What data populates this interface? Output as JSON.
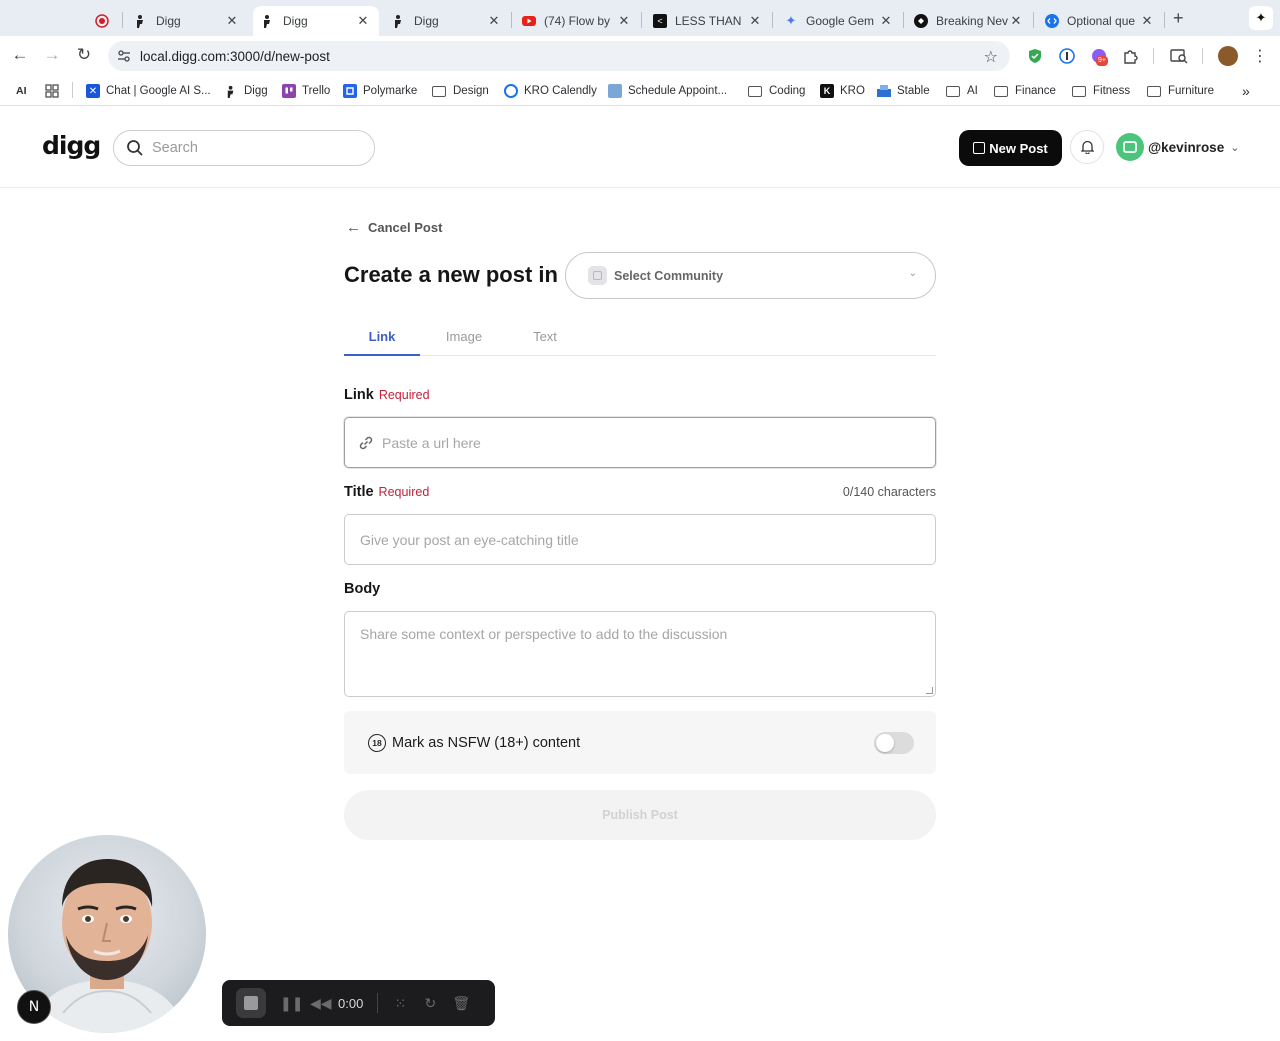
{
  "browser": {
    "tabs": [
      {
        "label": "",
        "icon": "record-icon",
        "active": false
      },
      {
        "label": "Digg",
        "icon": "digg-icon",
        "active": false
      },
      {
        "label": "Digg",
        "icon": "digg-icon",
        "active": true
      },
      {
        "label": "Digg",
        "icon": "digg-icon",
        "active": false
      },
      {
        "label": "(74) Flow by",
        "icon": "youtube-icon",
        "active": false
      },
      {
        "label": "LESS THAN",
        "icon": "lessthan-icon",
        "active": false
      },
      {
        "label": "Google Gem",
        "icon": "gemini-icon",
        "active": false
      },
      {
        "label": "Breaking Nev",
        "icon": "breaking-icon",
        "active": false
      },
      {
        "label": "Optional que",
        "icon": "optional-icon",
        "active": false
      }
    ],
    "new_tab": "+",
    "url": "local.digg.com:3000/d/new-post",
    "bookmarks": [
      {
        "label": "AI",
        "type": "text"
      },
      {
        "label": "",
        "type": "apps"
      },
      {
        "label": "Chat | Google AI S...",
        "type": "site"
      },
      {
        "label": "Digg",
        "type": "site"
      },
      {
        "label": "Trello",
        "type": "site"
      },
      {
        "label": "Polymarke",
        "type": "site"
      },
      {
        "label": "Design",
        "type": "folder"
      },
      {
        "label": "KRO Calendly",
        "type": "site"
      },
      {
        "label": "Schedule Appoint...",
        "type": "site"
      },
      {
        "label": "Coding",
        "type": "folder"
      },
      {
        "label": "KRO",
        "type": "site"
      },
      {
        "label": "Stable",
        "type": "site"
      },
      {
        "label": "AI",
        "type": "folder"
      },
      {
        "label": "Finance",
        "type": "folder"
      },
      {
        "label": "Fitness",
        "type": "folder"
      },
      {
        "label": "Furniture",
        "type": "folder"
      }
    ],
    "bookmarks_overflow": "»",
    "extension_badge": "9+"
  },
  "header": {
    "logo": "digg",
    "search_placeholder": "Search",
    "new_post_label": "New Post",
    "username": "@kevinrose"
  },
  "form": {
    "cancel_label": "Cancel Post",
    "title_prefix": "Create a new post in",
    "community_placeholder": "Select Community",
    "tabs": [
      {
        "label": "Link",
        "active": true
      },
      {
        "label": "Image",
        "active": false
      },
      {
        "label": "Text",
        "active": false
      }
    ],
    "link_label": "Link",
    "required_label": "Required",
    "link_placeholder": "Paste a url here",
    "title_label": "Title",
    "title_counter": "0/140 characters",
    "title_placeholder": "Give your post an eye-catching title",
    "body_label": "Body",
    "body_placeholder": "Share some context or perspective to add to the discussion",
    "nsfw_badge": "18",
    "nsfw_label": "Mark as NSFW (18+) content",
    "nsfw_enabled": false,
    "publish_label": "Publish Post"
  },
  "overlay": {
    "n_badge": "N",
    "recorder_time": "0:00"
  },
  "colors": {
    "accent_blue": "#3d5fc9",
    "required_red": "#c0233a",
    "button_black": "#0b0b0b",
    "avatar_green": "#4cc47b"
  }
}
